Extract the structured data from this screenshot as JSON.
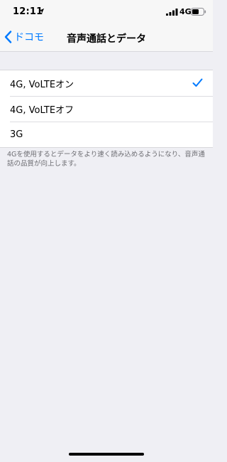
{
  "status_bar": {
    "time": "12:11",
    "network": "4G"
  },
  "nav": {
    "back_label": "ドコモ",
    "title": "音声通話とデータ"
  },
  "options": [
    {
      "label": "4G, VoLTEオン",
      "selected": true
    },
    {
      "label": "4G, VoLTEオフ",
      "selected": false
    },
    {
      "label": "3G",
      "selected": false
    }
  ],
  "footer_note": "4Gを使用するとデータをより速く読み込めるようになり、音声通話の品質が向上します。",
  "colors": {
    "accent": "#007aff",
    "background": "#efeff4",
    "cell": "#ffffff"
  },
  "icons": {
    "back": "chevron-left-icon",
    "selected": "checkmark-icon"
  }
}
